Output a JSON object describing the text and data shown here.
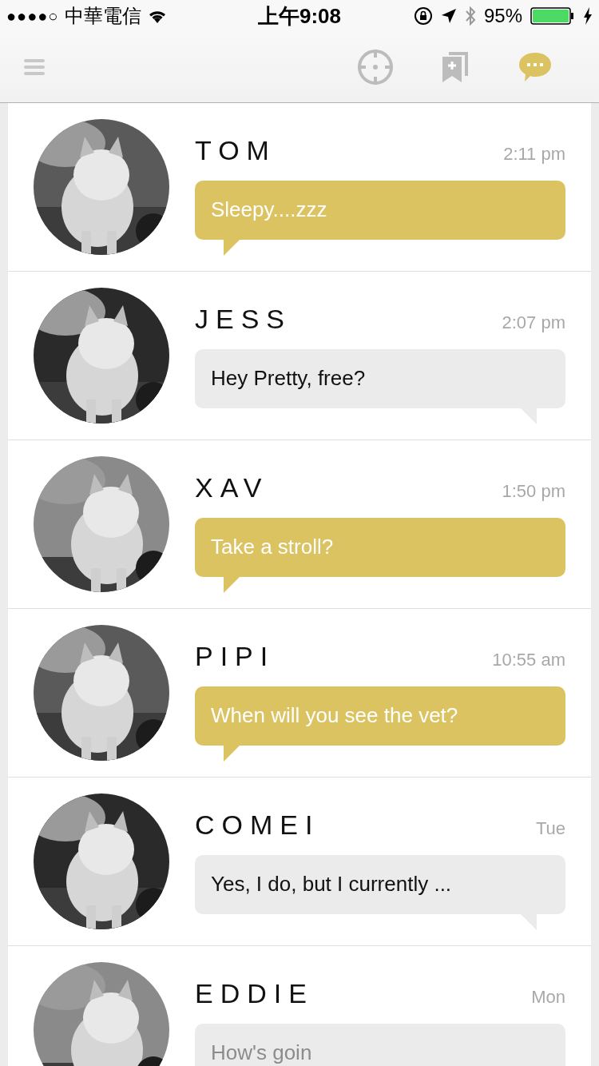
{
  "status_bar": {
    "signal": "●●●●○",
    "carrier": "中華電信",
    "time": "上午9:08",
    "battery": "95%"
  },
  "nav": {
    "tabs": [
      {
        "kind": "locate",
        "selected": false
      },
      {
        "kind": "bookmarks",
        "selected": false
      },
      {
        "kind": "chat",
        "selected": true
      }
    ]
  },
  "conversations": [
    {
      "name": "TOM",
      "time": "2:11 pm",
      "message": "Sleepy....zzz",
      "kind": "highlighted"
    },
    {
      "name": "JESS",
      "time": "2:07 pm",
      "message": "Hey Pretty, free?",
      "kind": "plain"
    },
    {
      "name": "XAV",
      "time": "1:50 pm",
      "message": "Take a stroll?",
      "kind": "highlighted"
    },
    {
      "name": "PIPI",
      "time": "10:55 am",
      "message": "When will you see the vet?",
      "kind": "highlighted"
    },
    {
      "name": "COMEI",
      "time": "Tue",
      "message": "Yes, I do, but I currently ...",
      "kind": "plain"
    },
    {
      "name": "EDDIE",
      "time": "Mon",
      "message": "How's goin",
      "kind": "faded"
    }
  ]
}
